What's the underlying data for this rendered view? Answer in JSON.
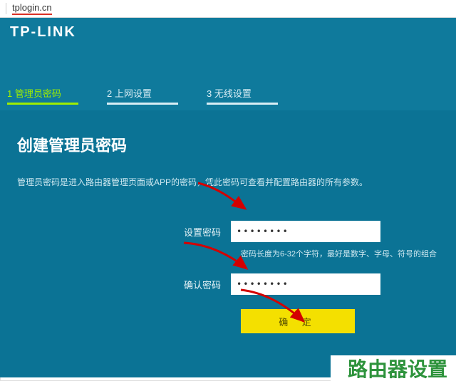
{
  "address_bar": {
    "url": "tplogin.cn"
  },
  "brand": "TP-LINK",
  "steps": [
    {
      "label": "1 管理员密码",
      "active": true
    },
    {
      "label": "2 上网设置",
      "active": false
    },
    {
      "label": "3 无线设置",
      "active": false
    }
  ],
  "page": {
    "title": "创建管理员密码",
    "desc": "管理员密码是进入路由器管理页面或APP的密码，凭此密码可查看并配置路由器的所有参数。"
  },
  "form": {
    "pwd_label": "设置密码",
    "pwd_value": "••••••••",
    "pwd_hint": "密码长度为6-32个字符，最好是数字、字母、符号的组合",
    "confirm_label": "确认密码",
    "confirm_value": "••••••••",
    "submit_label": "确 定"
  },
  "watermark": "路由器设置"
}
